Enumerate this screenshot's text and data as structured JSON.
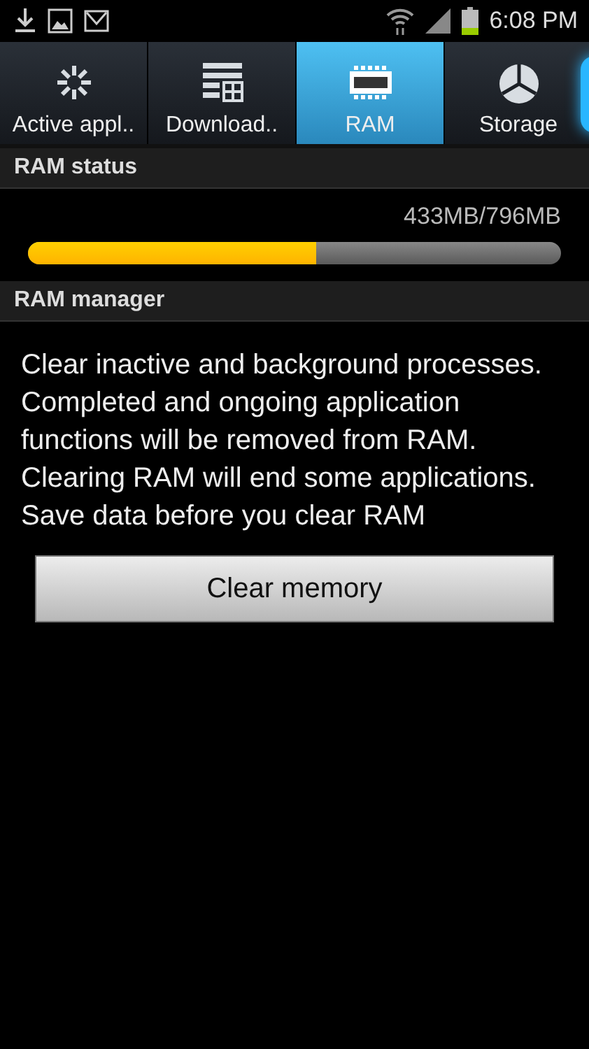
{
  "status_bar": {
    "time": "6:08 PM"
  },
  "tabs": [
    {
      "label": "Active appl..",
      "selected": false
    },
    {
      "label": "Download..",
      "selected": false
    },
    {
      "label": "RAM",
      "selected": true
    },
    {
      "label": "Storage",
      "selected": false
    }
  ],
  "ram_status": {
    "header": "RAM status",
    "reading": "433MB/796MB",
    "level": 0.54
  },
  "ram_manager": {
    "header": "RAM manager",
    "description": "Clear inactive and background processes. Completed and ongoing application functions will be removed from RAM. Clearing RAM will end some applications. Save data before you clear RAM",
    "button": "Clear memory"
  }
}
